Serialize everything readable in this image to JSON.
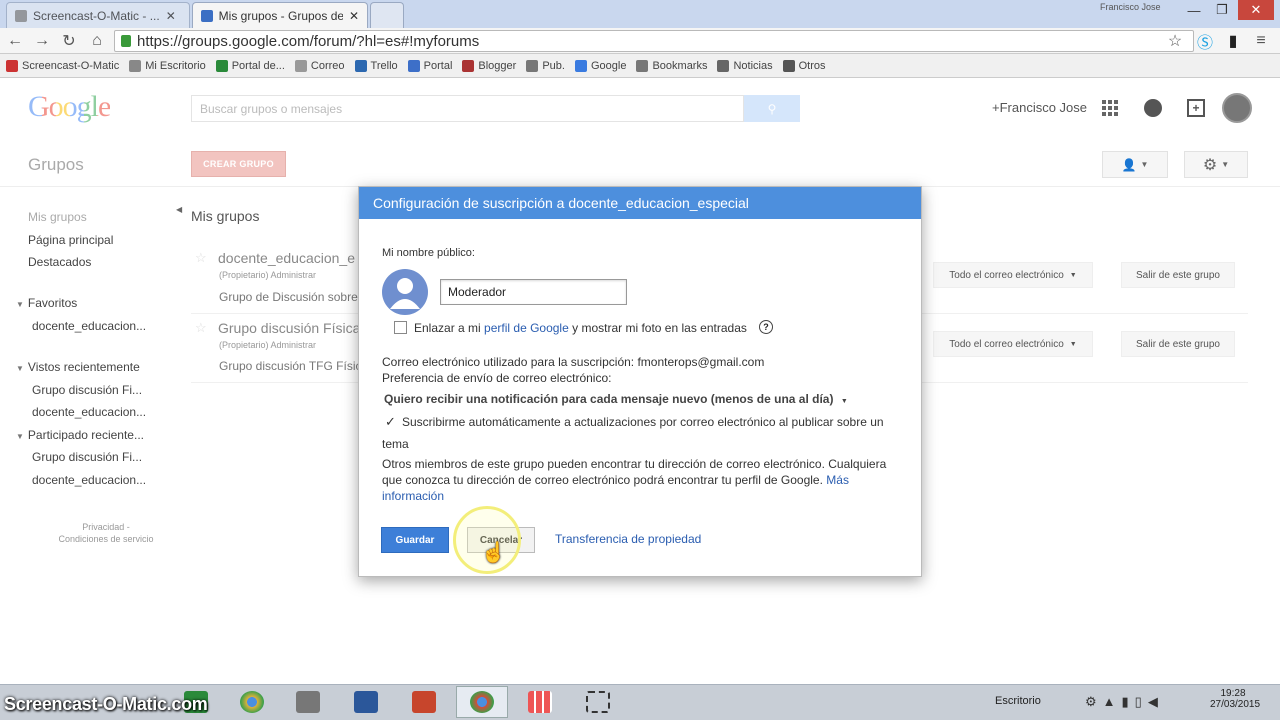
{
  "browser": {
    "tabs": [
      {
        "label": "Screencast-O-Matic - ..."
      },
      {
        "label": "Mis grupos - Grupos de G"
      },
      {
        "label": ""
      }
    ],
    "url": "https://groups.google.com/forum/?hl=es#!myforums",
    "window_user": "Francisco Jose",
    "bookmarks": [
      "Screencast-O-Matic",
      "Mi Escritorio",
      "Portal de...",
      "Correo",
      "Trello",
      "Portal",
      "Blogger",
      "Pub.",
      "Google",
      "Bookmarks",
      "Noticias",
      "Otros"
    ],
    "colors": {
      "accent": "#4d8fdd"
    }
  },
  "header": {
    "logo": "Google",
    "search_placeholder": "Buscar grupos o mensajes",
    "user_name": "+Francisco Jose"
  },
  "subheader": {
    "title": "Grupos",
    "create_button": "CREAR GRUPO"
  },
  "sidebar": {
    "items": [
      {
        "label": "Mis grupos"
      },
      {
        "label": "Página principal"
      },
      {
        "label": "Destacados"
      }
    ],
    "sections": [
      {
        "title": "Favoritos",
        "items": [
          "docente_educacion..."
        ]
      },
      {
        "title": "Vistos recientemente",
        "items": [
          "Grupo discusión Fi...",
          "docente_educacion..."
        ]
      },
      {
        "title": "Participado reciente...",
        "items": [
          "Grupo discusión Fi...",
          "docente_educacion..."
        ]
      }
    ],
    "footer": [
      "Privacidad -",
      "Condiciones de servicio"
    ]
  },
  "main": {
    "title": "Mis grupos",
    "groups": [
      {
        "name": "docente_educacion_e",
        "role": "(Propietario)",
        "admin": "Administrar",
        "description": "Grupo de Discusión sobre",
        "delivery": "Todo el correo electrónico",
        "leave": "Salir de este grupo"
      },
      {
        "name": "Grupo discusión Física",
        "role": "(Propietario)",
        "admin": "Administrar",
        "description": "Grupo discusión TFG Física",
        "delivery": "Todo el correo electrónico",
        "leave": "Salir de este grupo"
      }
    ]
  },
  "dialog": {
    "title": "Configuración de suscripción a docente_educacion_especial",
    "public_name_label": "Mi nombre público:",
    "public_name_value": "Moderador",
    "link_profile_prefix": "Enlazar a mi",
    "link_profile_link": "perfil de Google",
    "link_profile_suffix": "y mostrar mi foto en las entradas",
    "email_label": "Correo electrónico utilizado para la suscripción: fmonterops@gmail.com",
    "pref_label": "Preferencia de envío de correo electrónico:",
    "pref_value": "Quiero recibir una notificación para cada mensaje nuevo (menos de una al día)",
    "auto_subscribe_line1": "Suscribirme automáticamente a actualizaciones por correo electrónico al publicar sobre un",
    "auto_subscribe_line2": "tema",
    "notice_line1": "Otros miembros de este grupo pueden encontrar tu dirección de correo electrónico. Cualquiera",
    "notice_line2": "que conozca tu dirección de correo electrónico podrá encontrar tu perfil de Google.",
    "notice_more1": "Más",
    "notice_more2": "información",
    "save_button": "Guardar",
    "cancel_button": "Cancelar",
    "transfer_link": "Transferencia de propiedad"
  },
  "taskbar": {
    "desktop_label": "Escritorio",
    "time": "19:28",
    "date": "27/03/2015",
    "watermark": "Screencast-O-Matic.com"
  }
}
